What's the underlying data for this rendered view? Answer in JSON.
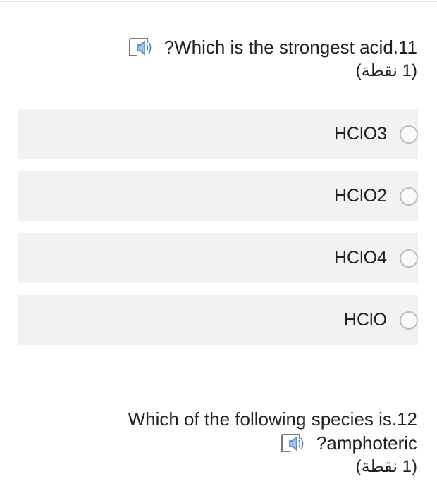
{
  "question_11": {
    "text": "?Which is the strongest acid.11",
    "points": "(1 نقطة)",
    "options": [
      {
        "label": "HClO3"
      },
      {
        "label": "HClO2"
      },
      {
        "label": "HClO4"
      },
      {
        "label": "HClO"
      }
    ]
  },
  "question_12": {
    "line1": "Which of the following species is.12",
    "line2": "?amphoteric",
    "points": "(1 نقطة)"
  },
  "icons": {
    "speaker": "speaker-icon",
    "radio": "radio-unchecked"
  },
  "colors": {
    "option_background": "#f2f2f2",
    "radio_border": "#bdbdbd",
    "text": "#202124"
  }
}
